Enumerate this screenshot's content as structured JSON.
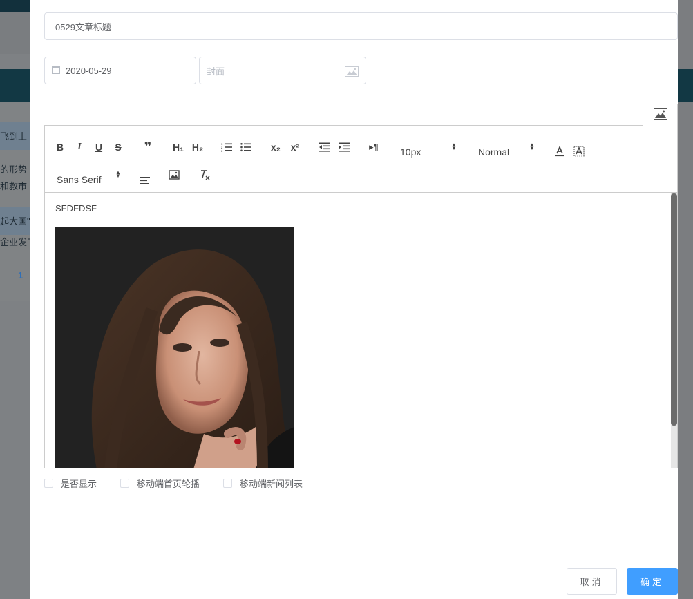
{
  "background": {
    "texts": [
      "飞到上",
      "的形势",
      "和救市",
      "起大国\"的",
      "企业发工"
    ],
    "page_number": "1"
  },
  "form": {
    "title_value": "0529文章标题",
    "date_value": "2020-05-29",
    "cover_placeholder": "封面"
  },
  "toolbar": {
    "bold": "B",
    "italic": "I",
    "underline": "U",
    "strike": "S",
    "blockquote": "❞",
    "h1": "H₁",
    "h2": "H₂",
    "subscript": "x₂",
    "superscript": "x²",
    "direction": "▸¶",
    "size_value": "10px",
    "header_value": "Normal",
    "font_value": "Sans Serif"
  },
  "editor": {
    "text": "SFDFDSF"
  },
  "checkboxes": [
    {
      "label": "是否显示",
      "checked": false
    },
    {
      "label": "移动端首页轮播",
      "checked": false
    },
    {
      "label": "移动端新闻列表",
      "checked": false
    }
  ],
  "buttons": {
    "cancel": "取消",
    "ok": "确定"
  },
  "colors": {
    "primary": "#409eff",
    "overlay": "#7e8184",
    "navbar": "#123844"
  }
}
